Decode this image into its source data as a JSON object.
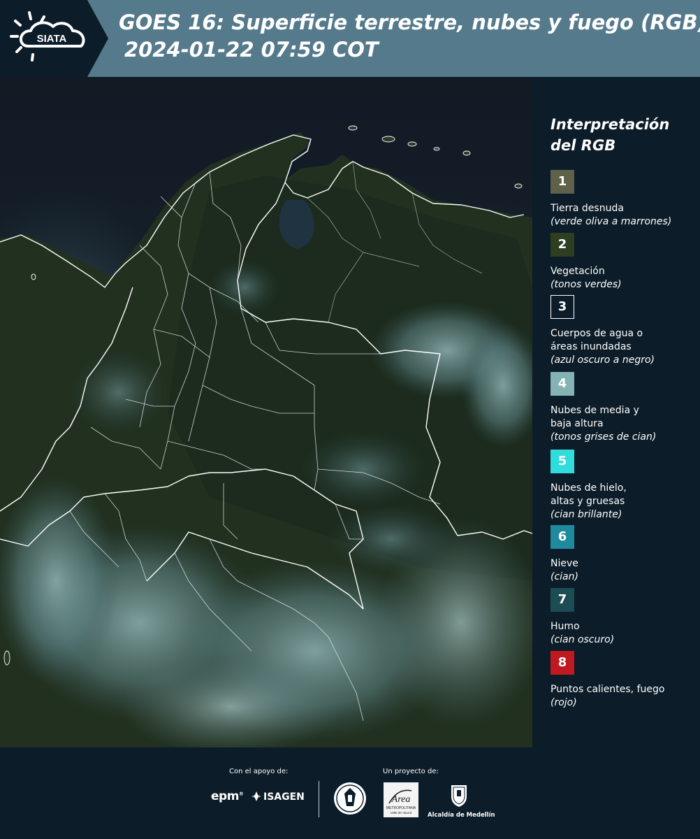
{
  "header": {
    "logo_text": "SIATA",
    "title": "GOES 16: Superficie terrestre, nubes y fuego (RGB)",
    "timestamp": "2024-01-22 07:59 COT"
  },
  "legend": {
    "title_line1": "Interpretación",
    "title_line2": "del RGB",
    "items": [
      {
        "number": "1",
        "color": "#60614a",
        "lines": [
          "Tierra desnuda"
        ],
        "note": "(verde oliva a marrones)"
      },
      {
        "number": "2",
        "color": "#2e3f21",
        "lines": [
          "Vegetación"
        ],
        "note": "(tonos verdes)"
      },
      {
        "number": "3",
        "color": "#0c1c28",
        "lines": [
          "Cuerpos de agua o",
          "áreas inundadas"
        ],
        "note": "(azul oscuro a negro)"
      },
      {
        "number": "4",
        "color": "#85b2b2",
        "lines": [
          "Nubes de media y",
          "baja altura"
        ],
        "note": "(tonos grises de cian)"
      },
      {
        "number": "5",
        "color": "#30dcdc",
        "lines": [
          "Nubes de hielo,",
          "altas y gruesas"
        ],
        "note": "(cian brillante)"
      },
      {
        "number": "6",
        "color": "#1f8a9e",
        "lines": [
          "Nieve"
        ],
        "note": "(cian)"
      },
      {
        "number": "7",
        "color": "#1c4d55",
        "lines": [
          "Humo"
        ],
        "note": "(cian oscuro)"
      },
      {
        "number": "8",
        "color": "#c0191f",
        "lines": [
          "Puntos calientes, fuego"
        ],
        "note": "(rojo)"
      }
    ]
  },
  "footer": {
    "support_label": "Con el apoyo de:",
    "project_label": "Un proyecto de:",
    "epm": "epm",
    "isagen": "ISAGEN",
    "metro_line1": "Área",
    "metro_line2": "METROPOLITANA",
    "metro_line3": "Valle de Aburrá",
    "alcaldia": "Alcaldía de Medellín"
  }
}
